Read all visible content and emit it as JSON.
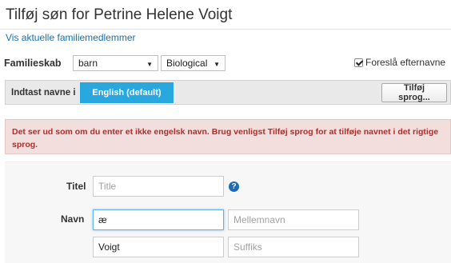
{
  "page": {
    "title": "Tilføj søn for Petrine Helene Voigt",
    "family_link": "Vis aktuelle familiemedlemmer"
  },
  "relationship": {
    "label": "Familieskab",
    "type_value": "barn",
    "bio_value": "Biological",
    "suggest_label": "Foreslå efternavne",
    "suggest_checked": true
  },
  "language": {
    "label": "Indtast navne i",
    "active_tab": "English (default)",
    "add_button": "Tilføj sprog..."
  },
  "alert": {
    "message": "Det ser ud som om du enter et ikke engelsk navn. Brug venligst Tilføj sprog for at tilføje navnet i det rigtige sprog."
  },
  "form": {
    "title_label": "Titel",
    "title_placeholder": "Title",
    "name_label": "Navn",
    "first_name_value": "æ",
    "middle_name_placeholder": "Mellemnavn",
    "last_name_value": "Voigt",
    "suffix_placeholder": "Suffiks",
    "help_glyph": "?"
  },
  "colors": {
    "accent": "#29a8e0",
    "link": "#1b6fb5",
    "alert_bg": "#f3dede",
    "alert_text": "#b52b27"
  },
  "icons": {
    "dropdown": "chevron-down-icon",
    "help": "question-circle-icon",
    "checkbox": "checkbox-checked-icon"
  }
}
